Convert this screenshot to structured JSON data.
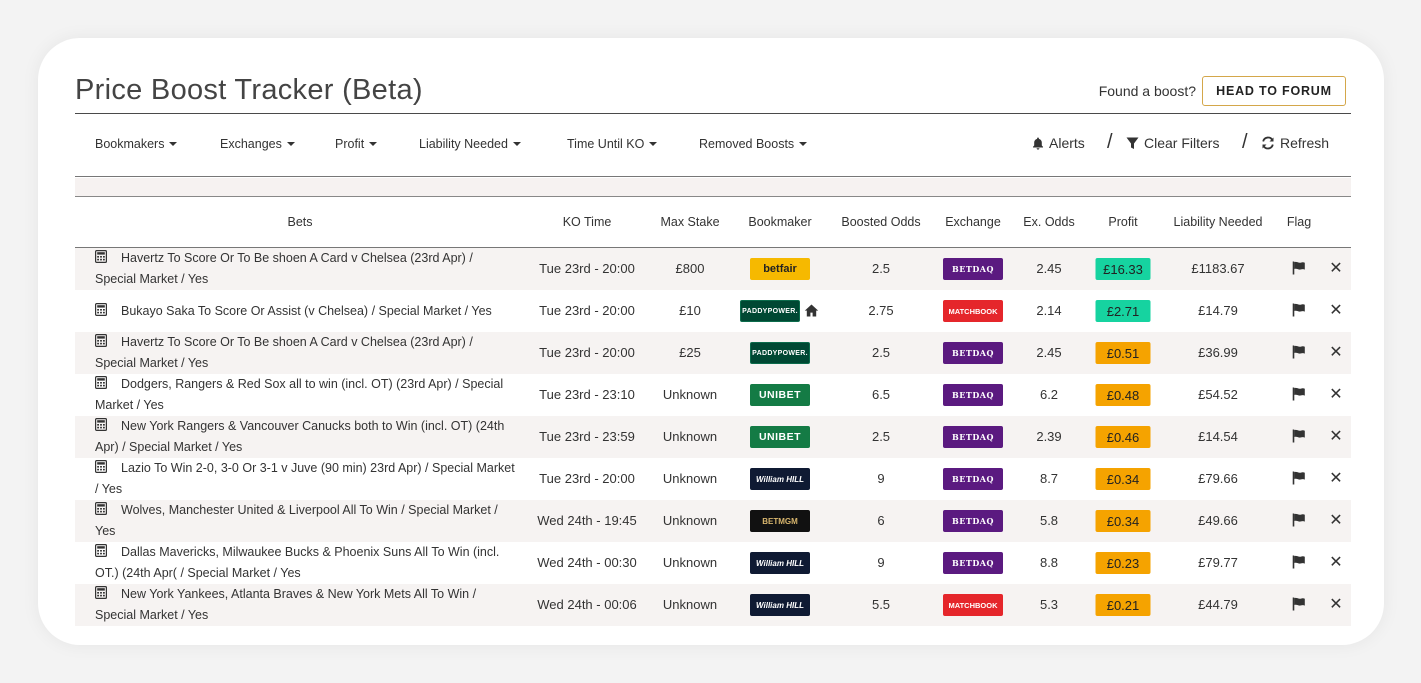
{
  "header": {
    "title": "Price Boost Tracker (Beta)",
    "found_text": "Found a boost?",
    "forum_button": "HEAD TO FORUM"
  },
  "filters": [
    {
      "label": "Bookmakers"
    },
    {
      "label": "Exchanges"
    },
    {
      "label": "Profit"
    },
    {
      "label": "Liability Needed"
    },
    {
      "label": "Time Until KO"
    },
    {
      "label": "Removed Boosts"
    }
  ],
  "tools": {
    "alerts": "Alerts",
    "clear_filters": "Clear Filters",
    "refresh": "Refresh",
    "separator": "/"
  },
  "columns": [
    "Bets",
    "KO Time",
    "Max Stake",
    "Bookmaker",
    "Boosted Odds",
    "Exchange",
    "Ex. Odds",
    "Profit",
    "Liability Needed",
    "Flag"
  ],
  "colors": {
    "profit_high": "#16d3a0",
    "profit_low": "#f5a300",
    "accent_border": "#d4a74a"
  },
  "rows": [
    {
      "bet": "Havertz To Score Or To Be shoen A Card v Chelsea (23rd Apr) / Special Market / Yes",
      "ko": "Tue 23rd - 20:00",
      "stake": "£800",
      "bookmaker": "betfair",
      "boosted": "2.5",
      "exchange": "BETDAQ",
      "ex_odds": "2.45",
      "profit": "£16.33",
      "profit_level": "high",
      "liability": "£1183.67"
    },
    {
      "bet": "Bukayo Saka To Score Or Assist (v Chelsea) / Special Market / Yes",
      "ko": "Tue 23rd - 20:00",
      "stake": "£10",
      "bookmaker": "PADDYPOWER.",
      "boosted": "2.75",
      "exchange": "MATCHBOOK",
      "ex_odds": "2.14",
      "profit": "£2.71",
      "profit_level": "high",
      "liability": "£14.79"
    },
    {
      "bet": "Havertz To Score Or To Be shoen A Card v Chelsea (23rd Apr) / Special Market / Yes",
      "ko": "Tue 23rd - 20:00",
      "stake": "£25",
      "bookmaker": "PADDYPOWER.",
      "boosted": "2.5",
      "exchange": "BETDAQ",
      "ex_odds": "2.45",
      "profit": "£0.51",
      "profit_level": "low",
      "liability": "£36.99"
    },
    {
      "bet": "Dodgers, Rangers & Red Sox all to win (incl. OT) (23rd Apr) / Special Market / Yes",
      "ko": "Tue 23rd - 23:10",
      "stake": "Unknown",
      "bookmaker": "UNIBET",
      "boosted": "6.5",
      "exchange": "BETDAQ",
      "ex_odds": "6.2",
      "profit": "£0.48",
      "profit_level": "low",
      "liability": "£54.52"
    },
    {
      "bet": "New York Rangers & Vancouver Canucks both to Win (incl. OT) (24th Apr) / Special Market / Yes",
      "ko": "Tue 23rd - 23:59",
      "stake": "Unknown",
      "bookmaker": "UNIBET",
      "boosted": "2.5",
      "exchange": "BETDAQ",
      "ex_odds": "2.39",
      "profit": "£0.46",
      "profit_level": "low",
      "liability": "£14.54"
    },
    {
      "bet": "Lazio To Win 2-0, 3-0 Or 3-1 v Juve (90 min) 23rd Apr) / Special Market / Yes",
      "ko": "Tue 23rd - 20:00",
      "stake": "Unknown",
      "bookmaker": "William HILL",
      "boosted": "9",
      "exchange": "BETDAQ",
      "ex_odds": "8.7",
      "profit": "£0.34",
      "profit_level": "low",
      "liability": "£79.66"
    },
    {
      "bet": "Wolves, Manchester United & Liverpool All To Win / Special Market / Yes",
      "ko": "Wed 24th - 19:45",
      "stake": "Unknown",
      "bookmaker": "BETMGM",
      "boosted": "6",
      "exchange": "BETDAQ",
      "ex_odds": "5.8",
      "profit": "£0.34",
      "profit_level": "low",
      "liability": "£49.66"
    },
    {
      "bet": "Dallas Mavericks, Milwaukee Bucks & Phoenix Suns All To Win (incl. OT.) (24th Apr( / Special Market / Yes",
      "ko": "Wed 24th - 00:30",
      "stake": "Unknown",
      "bookmaker": "William HILL",
      "boosted": "9",
      "exchange": "BETDAQ",
      "ex_odds": "8.8",
      "profit": "£0.23",
      "profit_level": "low",
      "liability": "£79.77"
    },
    {
      "bet": "New York Yankees, Atlanta Braves & New York Mets All To Win / Special Market / Yes",
      "ko": "Wed 24th - 00:06",
      "stake": "Unknown",
      "bookmaker": "William HILL",
      "boosted": "5.5",
      "exchange": "MATCHBOOK",
      "ex_odds": "5.3",
      "profit": "£0.21",
      "profit_level": "low",
      "liability": "£44.79"
    }
  ]
}
